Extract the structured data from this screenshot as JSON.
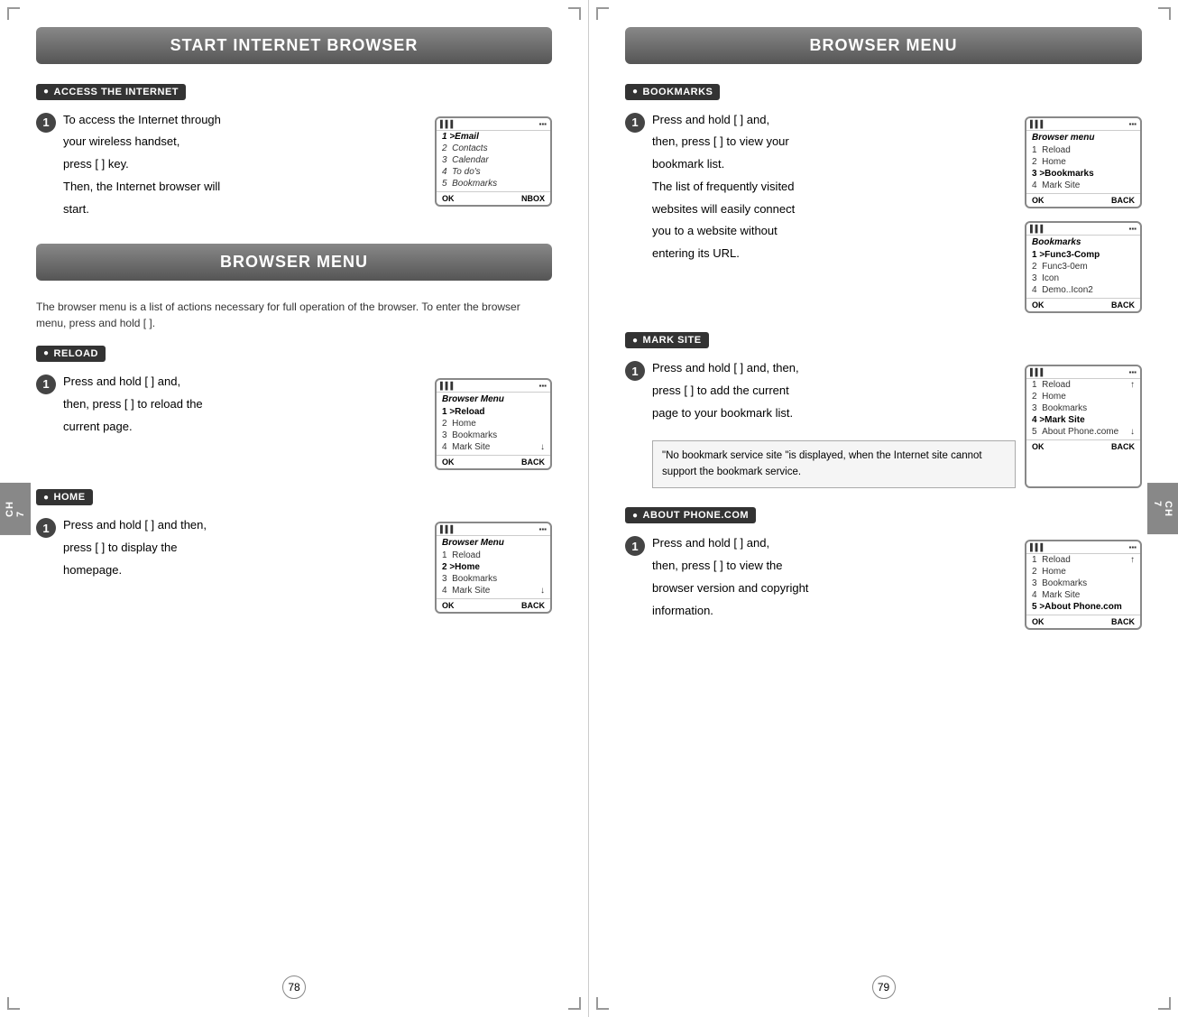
{
  "leftPage": {
    "header": "START INTERNET BROWSER",
    "section1": {
      "label": "ACCESS THE INTERNET",
      "step1": {
        "number": "1",
        "lines": [
          "To access the Internet through",
          "your wireless handset,",
          "press [  ] key.",
          "Then, the Internet browser will",
          "start."
        ],
        "phone": {
          "signal": "▌▌▌",
          "battery": "▪▪▪",
          "items": [
            "1 >Email",
            "2  Contacts",
            "3  Calendar",
            "4  To do's",
            "5  Bookmarks"
          ],
          "footer_left": "OK",
          "footer_right": "NBOX"
        }
      }
    },
    "section2": {
      "header": "BROWSER MENU",
      "desc": "The browser menu is a list of actions necessary for full operation of the browser. To enter the browser menu, press and hold [  ].",
      "reload": {
        "label": "RELOAD",
        "step1": {
          "number": "1",
          "lines": [
            "Press and hold [  ] and,",
            "then, press [  ] to reload the",
            "current page."
          ],
          "phone": {
            "signal": "▌▌▌",
            "battery": "▪▪▪",
            "title": "Browser Menu",
            "items": [
              "1 >Reload",
              "2  Home",
              "3  Bookmarks",
              "4  Mark Site"
            ],
            "arrow": "↓",
            "footer_left": "OK",
            "footer_right": "BACK"
          }
        }
      },
      "home": {
        "label": "HOME",
        "step1": {
          "number": "1",
          "lines": [
            "Press and hold [  ] and then,",
            "press [  ] to display the",
            "homepage."
          ],
          "phone": {
            "signal": "▌▌▌",
            "battery": "▪▪▪",
            "title": "Browser Menu",
            "items": [
              "1  Reload",
              "2 >Home",
              "3  Bookmarks",
              "4  Mark Site"
            ],
            "arrow": "↓",
            "footer_left": "OK",
            "footer_right": "BACK"
          }
        }
      }
    },
    "pageNumber": "78",
    "chapterLabel": "CH\n7"
  },
  "rightPage": {
    "header": "BROWSER MENU",
    "bookmarks": {
      "label": "BOOKMARKS",
      "step1": {
        "number": "1",
        "lines": [
          "Press and hold [  ] and,",
          "then, press [  ] to view your",
          "bookmark list.",
          "The list of frequently visited",
          "websites will easily connect",
          "you to a website without",
          "entering its URL."
        ],
        "phone1": {
          "signal": "▌▌▌",
          "battery": "▪▪▪",
          "title": "Browser menu",
          "items": [
            "1  Reload",
            "2  Home",
            "3 >Bookmarks",
            "4  Mark Site"
          ],
          "footer_left": "OK",
          "footer_right": "BACK"
        },
        "phone2": {
          "signal": "▌▌▌",
          "battery": "▪▪▪",
          "title": "Bookmarks",
          "items": [
            "1 >Func3-Comp",
            "2  Func3-0em",
            "3  Icon",
            "4  Demo..Icon2"
          ],
          "footer_left": "OK",
          "footer_right": "BACK"
        }
      }
    },
    "markSite": {
      "label": "MARK SITE",
      "step1": {
        "number": "1",
        "lines": [
          "Press and hold [  ] and, then,",
          "press [  ] to add the current",
          "page to your bookmark list."
        ],
        "note": "\"No bookmark service site \"is displayed, when the Internet site cannot support the bookmark service.",
        "phone": {
          "signal": "▌▌▌",
          "battery": "▪▪▪",
          "items": [
            "1  Reload",
            "2  Home",
            "3  Bookmarks",
            "4 >Mark Site",
            "5  About Phone.come"
          ],
          "arrow_1": "↑",
          "arrow_5": "↓",
          "footer_left": "OK",
          "footer_right": "BACK"
        }
      }
    },
    "aboutPhone": {
      "label": "ABOUT PHONE.COM",
      "step1": {
        "number": "1",
        "lines": [
          "Press and hold [  ] and,",
          "then, press [  ]  to view the",
          "browser version and copyright",
          "information."
        ],
        "phone": {
          "signal": "▌▌▌",
          "battery": "▪▪▪",
          "items": [
            "1  Reload",
            "2  Home",
            "3  Bookmarks",
            "4  Mark Site",
            "5 >About Phone.com"
          ],
          "arrow_1": "↑",
          "footer_left": "OK",
          "footer_right": "BACK"
        }
      }
    },
    "pageNumber": "79",
    "chapterLabel": "CH\n7"
  }
}
